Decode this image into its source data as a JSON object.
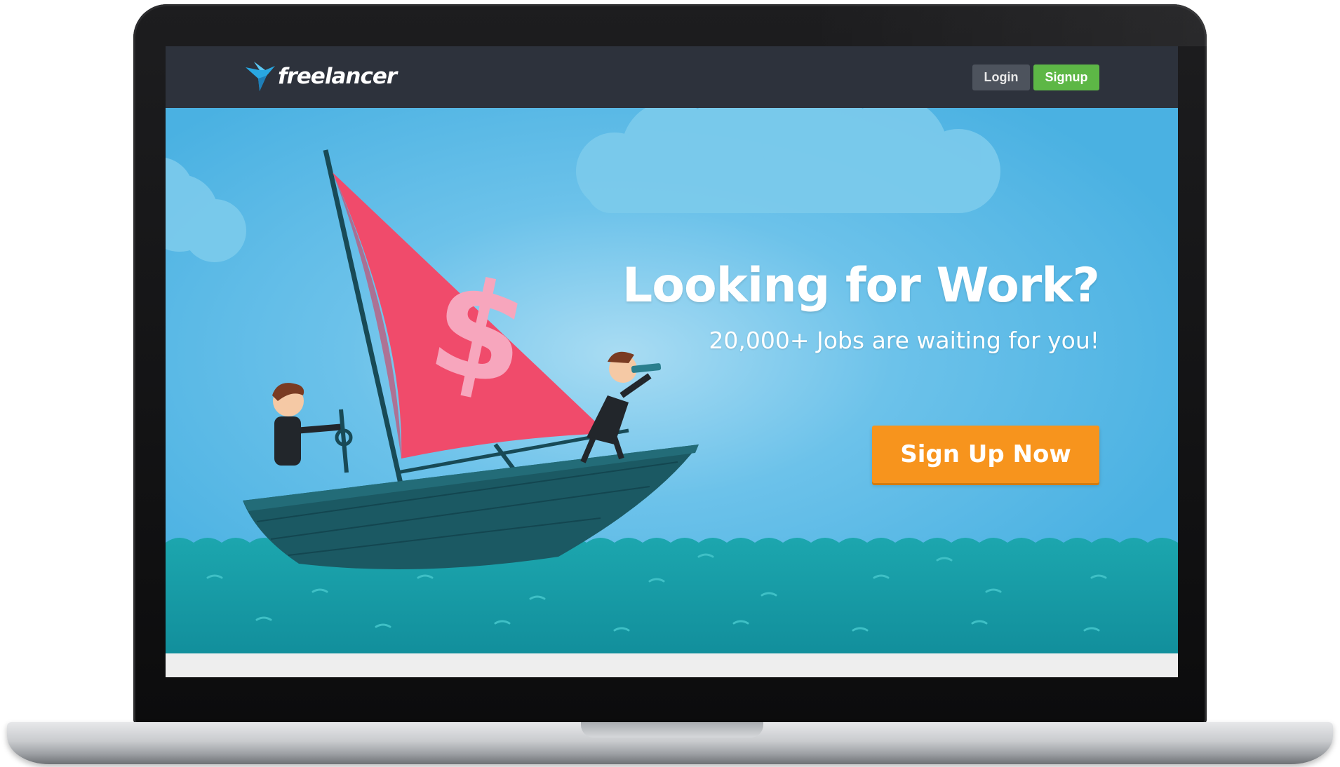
{
  "nav": {
    "logo_text": "freelancer",
    "login_label": "Login",
    "signup_label": "Signup"
  },
  "hero": {
    "headline": "Looking for Work?",
    "subline": "20,000+ Jobs are waiting for you!",
    "cta_label": "Sign Up Now",
    "sail_symbol": "$"
  },
  "colors": {
    "navbar": "#2d323c",
    "signup_green": "#5db746",
    "login_gray": "#4d535d",
    "sky": "#4fb3e3",
    "sea": "#1a9aa5",
    "sail": "#f24d6c",
    "cta_orange": "#f7941d"
  },
  "icons": {
    "logo": "freelancer-bird-icon"
  }
}
